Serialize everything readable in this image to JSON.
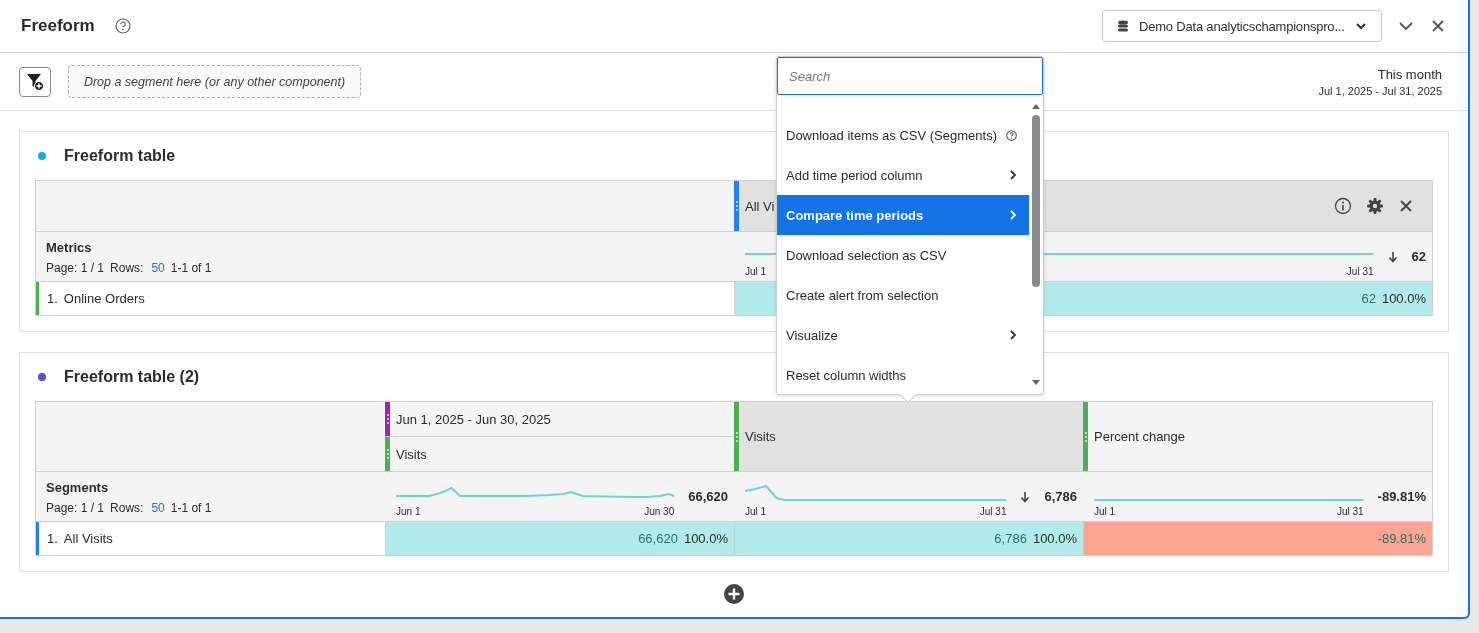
{
  "header": {
    "title": "Freeform",
    "datasource": "Demo Data analyticschampionspro..."
  },
  "segment_bar": {
    "placeholder": "Drop a segment here (or any other component)",
    "date_preset": "This month",
    "date_range": "Jul 1, 2025 - Jul 31, 2025"
  },
  "panels": [
    {
      "title": "Freeform table",
      "color": "#12b5c4",
      "table": {
        "dimension": "Metrics",
        "page": "Page: 1 / 1",
        "rows_label": "Rows:",
        "rows_value": "50",
        "range": "1-1 of 1",
        "columns": [
          {
            "headers": [
              {
                "text": "All Vi",
                "color": "#2680eb"
              }
            ],
            "selected": true,
            "controls": true,
            "summary": {
              "start": "Jul 1",
              "end": "Jul 31",
              "sorted": true,
              "total": "62"
            }
          }
        ],
        "rows": [
          {
            "index": "1.",
            "label": "Online Orders",
            "color": "#4caf50",
            "cells": [
              {
                "value": "62",
                "percent": "100.0%",
                "color": "#b2ebeb"
              }
            ]
          }
        ]
      }
    },
    {
      "title": "Freeform table (2)",
      "color": "#5a4fd6",
      "table": {
        "dimension": "Segments",
        "page": "Page: 1 / 1",
        "rows_label": "Rows:",
        "rows_value": "50",
        "range": "1-1 of 1",
        "columns": [
          {
            "headers": [
              {
                "text": "Jun 1, 2025 - Jun 30, 2025",
                "color": "#9c27b0"
              },
              {
                "text": "Visits",
                "color": "#4caf50"
              }
            ],
            "selected": false,
            "controls": false,
            "summary": {
              "start": "Jun 1",
              "end": "Jun 30",
              "sorted": false,
              "total": "66,620"
            }
          },
          {
            "headers": [
              {
                "text": "Visits",
                "color": "#4caf50"
              }
            ],
            "selected": true,
            "controls": false,
            "summary": {
              "start": "Jul 1",
              "end": "Jul 31",
              "sorted": true,
              "total": "6,786"
            }
          },
          {
            "headers": [
              {
                "text": "Percent change",
                "color": "#4caf50"
              }
            ],
            "selected": false,
            "controls": false,
            "summary": {
              "start": "Jul 1",
              "end": "Jul 31",
              "sorted": false,
              "total": "-89.81%"
            }
          }
        ],
        "rows": [
          {
            "index": "1.",
            "label": "All Visits",
            "color": "#2680eb",
            "cells": [
              {
                "value": "66,620",
                "percent": "100.0%",
                "color": "#b2ebeb"
              },
              {
                "value": "6,786",
                "percent": "100.0%",
                "color": "#b2ebeb"
              },
              {
                "value": "-89.81%",
                "color": "#fca591"
              }
            ]
          }
        ]
      }
    }
  ],
  "context_menu": {
    "search_placeholder": "Search",
    "items": [
      {
        "label": "Download items as CSV (Segments)",
        "submenu": false,
        "help": true,
        "selected": false
      },
      {
        "label": "Add time period column",
        "submenu": true,
        "help": false,
        "selected": false
      },
      {
        "label": "Compare time periods",
        "submenu": true,
        "help": false,
        "selected": true
      },
      {
        "label": "Download selection as CSV",
        "submenu": false,
        "help": false,
        "selected": false
      },
      {
        "label": "Create alert from selection",
        "submenu": false,
        "help": false,
        "selected": false
      },
      {
        "label": "Visualize",
        "submenu": true,
        "help": false,
        "selected": false
      },
      {
        "label": "Reset column widths",
        "submenu": false,
        "help": false,
        "selected": false
      }
    ]
  }
}
